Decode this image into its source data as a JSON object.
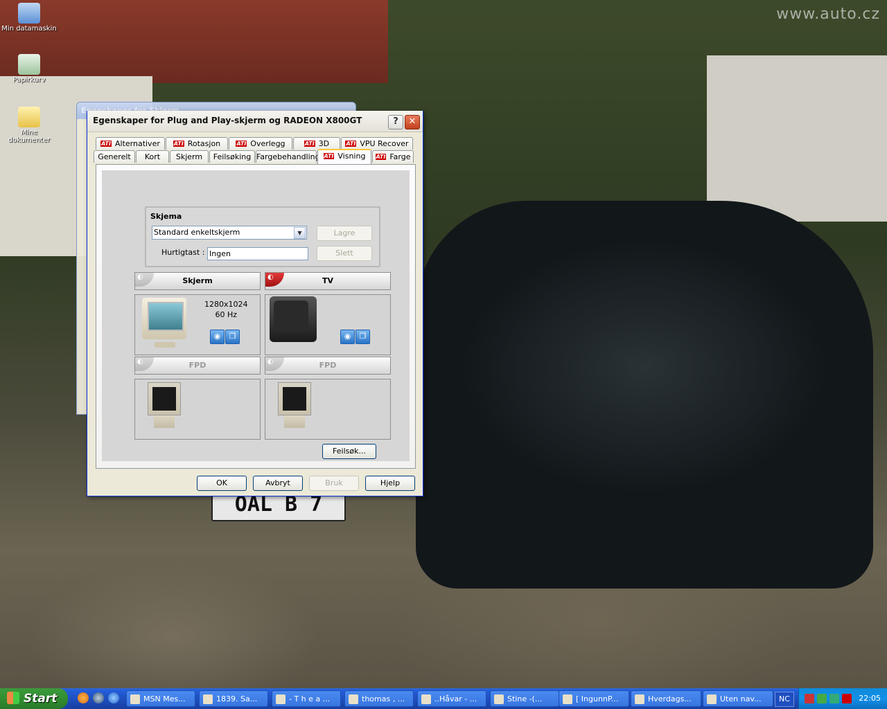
{
  "desktop": {
    "watermark": "www.auto.cz",
    "plate": "OAL B 7",
    "icons": [
      {
        "label": "Min datamaskin",
        "icon": "computer-icon"
      },
      {
        "label": "Papirkurv",
        "icon": "recycle-bin-icon"
      },
      {
        "label": "Mine dokumenter",
        "icon": "documents-folder-icon"
      }
    ]
  },
  "background_window": {
    "title": "Egenskaper for Skjerm"
  },
  "dialog": {
    "title": "Egenskaper for Plug and Play-skjerm og RADEON X800GT",
    "help_glyph": "?",
    "close_glyph": "✕",
    "tabs_row1": [
      "Alternativer",
      "Rotasjon",
      "Overlegg",
      "3D",
      "VPU Recover"
    ],
    "tabs_row2": [
      "Generelt",
      "Kort",
      "Skjerm",
      "Feilsøking",
      "Fargebehandling",
      "Visning",
      "Farge"
    ],
    "active_tab": "Visning",
    "ati_badge": "ATI",
    "scheme": {
      "title": "Skjema",
      "selected": "Standard enkeltskjerm",
      "apply_label": "Lagre",
      "delete_label": "Slett",
      "hotkey_label": "Hurtigtast :",
      "hotkey_value": "Ingen"
    },
    "displays": [
      {
        "name": "Skjerm",
        "resolution": "1280x1024",
        "refresh": "60 Hz",
        "enabled": true
      },
      {
        "name": "TV",
        "enabled": true
      },
      {
        "name": "FPD",
        "enabled": false
      },
      {
        "name": "FPD",
        "enabled": false
      }
    ],
    "troubleshoot_label": "Feilsøk...",
    "buttons": {
      "ok": "OK",
      "cancel": "Avbryt",
      "apply": "Bruk",
      "help": "Hjelp"
    }
  },
  "taskbar": {
    "start_label": "Start",
    "items": [
      "MSN Mes...",
      "1839. Sa...",
      "- T h e a ...",
      "thomas , ...",
      "..Håvar - ...",
      "Stine    -(...",
      "[ IngunnP...",
      "Hverdags...",
      "Uten nav..."
    ],
    "language": "NC",
    "clock": "22:05"
  }
}
